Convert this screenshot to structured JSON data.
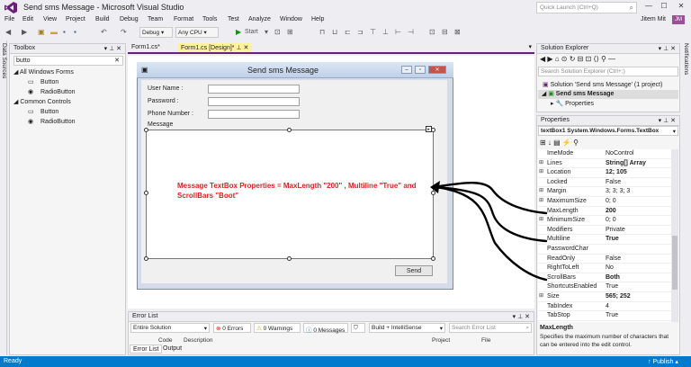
{
  "window": {
    "title": "Send sms Message - Microsoft Visual Studio",
    "quick_launch_placeholder": "Quick Launch (Ctrl+Q)",
    "user_name": "Jitem Mit",
    "user_initials": "JM"
  },
  "menu": [
    "File",
    "Edit",
    "View",
    "Project",
    "Build",
    "Debug",
    "Team",
    "Format",
    "Tools",
    "Test",
    "Analyze",
    "Window",
    "Help"
  ],
  "toolbar": {
    "config": "Debug",
    "platform": "Any CPU",
    "start_label": "Start"
  },
  "side_tabs": {
    "left": "Data Sources",
    "right": "Notifications"
  },
  "toolbox": {
    "title": "Toolbox",
    "search_value": "butto",
    "groups": [
      {
        "label": "All Windows Forms",
        "items": [
          "Button",
          "RadioButton"
        ]
      },
      {
        "label": "Common Controls",
        "items": [
          "Button",
          "RadioButton"
        ]
      }
    ]
  },
  "doc_tabs": [
    "Form1.cs*",
    "Form1.cs [Design]*"
  ],
  "form": {
    "title": "Send sms Message",
    "labels": [
      "User Name :",
      "Password :",
      "Phone Number :",
      "Message"
    ],
    "send_label": "Send",
    "annotation": "Message TextBox Properties = MaxLength \"200\" , Multiline \"True\" and ScrollBars \"Boot\""
  },
  "error_list": {
    "title": "Error List",
    "scope": "Entire Solution",
    "errors": "0 Errors",
    "warnings": "0 Warnings",
    "messages": "0 Messages",
    "build_filter": "Build + IntelliSense",
    "search_placeholder": "Search Error List",
    "columns": [
      "Code",
      "Description",
      "Project",
      "File"
    ],
    "tabs": [
      "Error List",
      "Output"
    ]
  },
  "solution_explorer": {
    "title": "Solution Explorer",
    "search_placeholder": "Search Solution Explorer (Ctrl+;)",
    "solution": "Solution 'Send sms Message' (1 project)",
    "project": "Send sms Message",
    "properties_node": "Properties"
  },
  "properties": {
    "title": "Properties",
    "object": "textBox1  System.Windows.Forms.TextBox",
    "rows": [
      {
        "expand": "",
        "name": "ImeMode",
        "value": "NoControl",
        "bold": false
      },
      {
        "expand": "⊞",
        "name": "Lines",
        "value": "String[] Array",
        "bold": true
      },
      {
        "expand": "⊞",
        "name": "Location",
        "value": "12; 105",
        "bold": true
      },
      {
        "expand": "",
        "name": "Locked",
        "value": "False",
        "bold": false
      },
      {
        "expand": "⊞",
        "name": "Margin",
        "value": "3; 3; 3; 3",
        "bold": false
      },
      {
        "expand": "⊞",
        "name": "MaximumSize",
        "value": "0; 0",
        "bold": false
      },
      {
        "expand": "",
        "name": "MaxLength",
        "value": "200",
        "bold": true
      },
      {
        "expand": "⊞",
        "name": "MinimumSize",
        "value": "0; 0",
        "bold": false
      },
      {
        "expand": "",
        "name": "Modifiers",
        "value": "Private",
        "bold": false
      },
      {
        "expand": "",
        "name": "Multiline",
        "value": "True",
        "bold": true
      },
      {
        "expand": "",
        "name": "PasswordChar",
        "value": "",
        "bold": false
      },
      {
        "expand": "",
        "name": "ReadOnly",
        "value": "False",
        "bold": false
      },
      {
        "expand": "",
        "name": "RightToLeft",
        "value": "No",
        "bold": false
      },
      {
        "expand": "",
        "name": "ScrollBars",
        "value": "Both",
        "bold": true
      },
      {
        "expand": "",
        "name": "ShortcutsEnabled",
        "value": "True",
        "bold": false
      },
      {
        "expand": "⊞",
        "name": "Size",
        "value": "565; 252",
        "bold": true
      },
      {
        "expand": "",
        "name": "TabIndex",
        "value": "4",
        "bold": false
      },
      {
        "expand": "",
        "name": "TabStop",
        "value": "True",
        "bold": false
      }
    ],
    "desc_title": "MaxLength",
    "desc_text": "Specifies the maximum number of characters that can be entered into the edit control."
  },
  "status": {
    "left": "Ready",
    "right": "Publish"
  },
  "colors": {
    "accent": "#007acc",
    "annotation": "#e02020",
    "active_tab": "#fff29d",
    "vs_purple": "#68217a"
  }
}
